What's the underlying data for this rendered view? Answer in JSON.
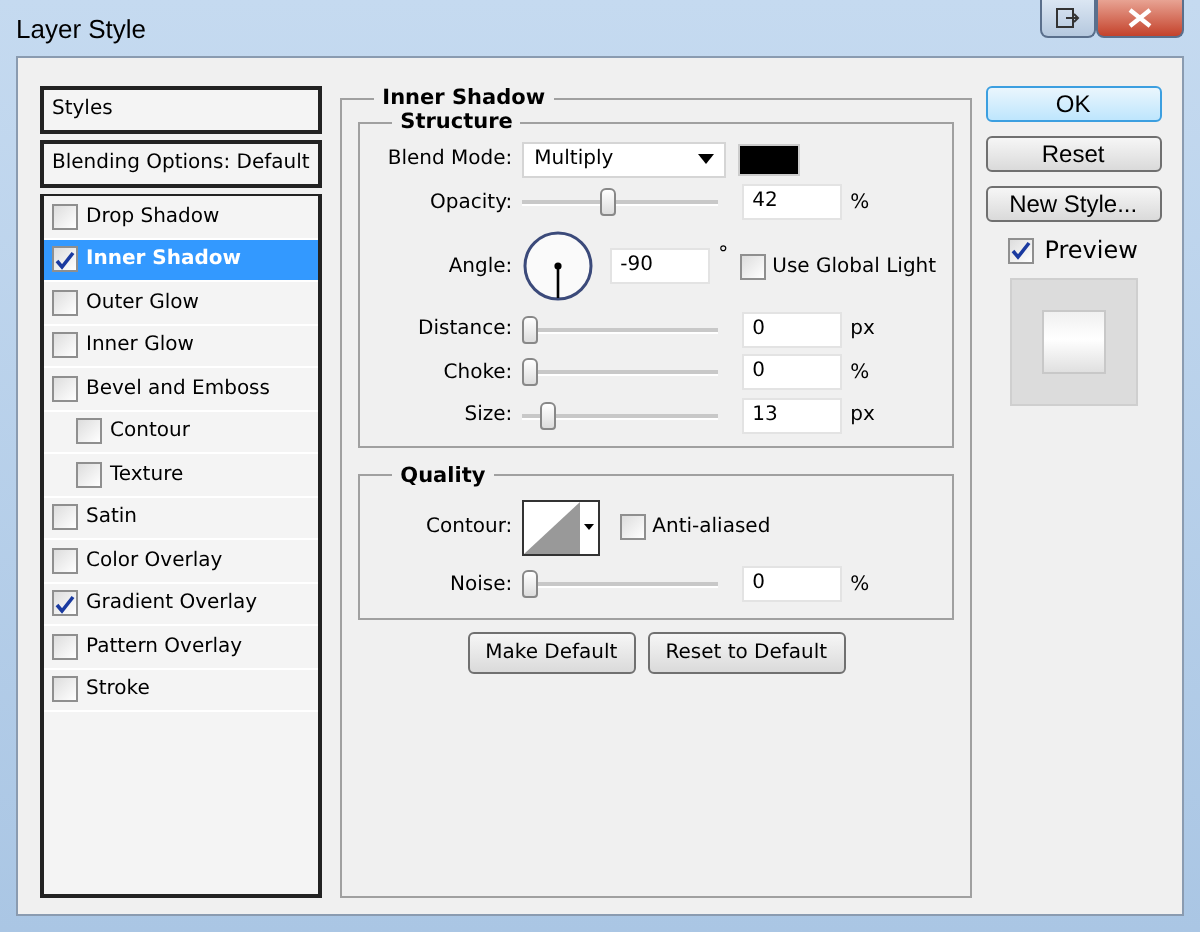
{
  "window": {
    "title": "Layer Style"
  },
  "styles_list": {
    "header": "Styles",
    "blending_options": "Blending Options: Default",
    "items": [
      {
        "label": "Drop Shadow",
        "checked": false,
        "selected": false
      },
      {
        "label": "Inner Shadow",
        "checked": true,
        "selected": true
      },
      {
        "label": "Outer Glow",
        "checked": false,
        "selected": false
      },
      {
        "label": "Inner Glow",
        "checked": false,
        "selected": false
      },
      {
        "label": "Bevel and Emboss",
        "checked": false,
        "selected": false,
        "children": [
          {
            "label": "Contour",
            "checked": false,
            "selected": false
          },
          {
            "label": "Texture",
            "checked": false,
            "selected": false
          }
        ]
      },
      {
        "label": "Satin",
        "checked": false,
        "selected": false
      },
      {
        "label": "Color Overlay",
        "checked": false,
        "selected": false
      },
      {
        "label": "Gradient Overlay",
        "checked": true,
        "selected": false
      },
      {
        "label": "Pattern Overlay",
        "checked": false,
        "selected": false
      },
      {
        "label": "Stroke",
        "checked": false,
        "selected": false
      }
    ]
  },
  "panel": {
    "title": "Inner Shadow",
    "structure": {
      "title": "Structure",
      "blend_mode_label": "Blend Mode:",
      "blend_mode": "Multiply",
      "rows": [
        {
          "kind": "slider",
          "label": "Opacity:",
          "level": 0.42,
          "value": "42",
          "unit": "%"
        },
        {
          "kind": "angle",
          "label": "Angle:",
          "value": "-90",
          "unit": "°",
          "checkbox": {
            "label": "Use Global Light",
            "checked": false
          }
        },
        {
          "kind": "slider",
          "label": "Distance:",
          "level": 0,
          "value": "0",
          "unit": "px"
        },
        {
          "kind": "slider",
          "label": "Choke:",
          "level": 0,
          "value": "0",
          "unit": "%"
        },
        {
          "kind": "slider",
          "label": "Size:",
          "level": 0.1,
          "value": "13",
          "unit": "px"
        }
      ]
    },
    "quality": {
      "title": "Quality",
      "contour_label": "Contour:",
      "anti_aliased": {
        "label": "Anti-aliased",
        "checked": false
      },
      "noise": {
        "label": "Noise:",
        "level": 0,
        "value": "0",
        "unit": "%"
      }
    },
    "buttons": [
      "Make Default",
      "Reset to Default"
    ]
  },
  "side": {
    "buttons": [
      {
        "label": "OK",
        "focused": true
      },
      {
        "label": "Reset",
        "focused": false
      },
      {
        "label": "New Style...",
        "focused": false
      }
    ],
    "preview": {
      "label": "Preview",
      "checked": true
    }
  }
}
